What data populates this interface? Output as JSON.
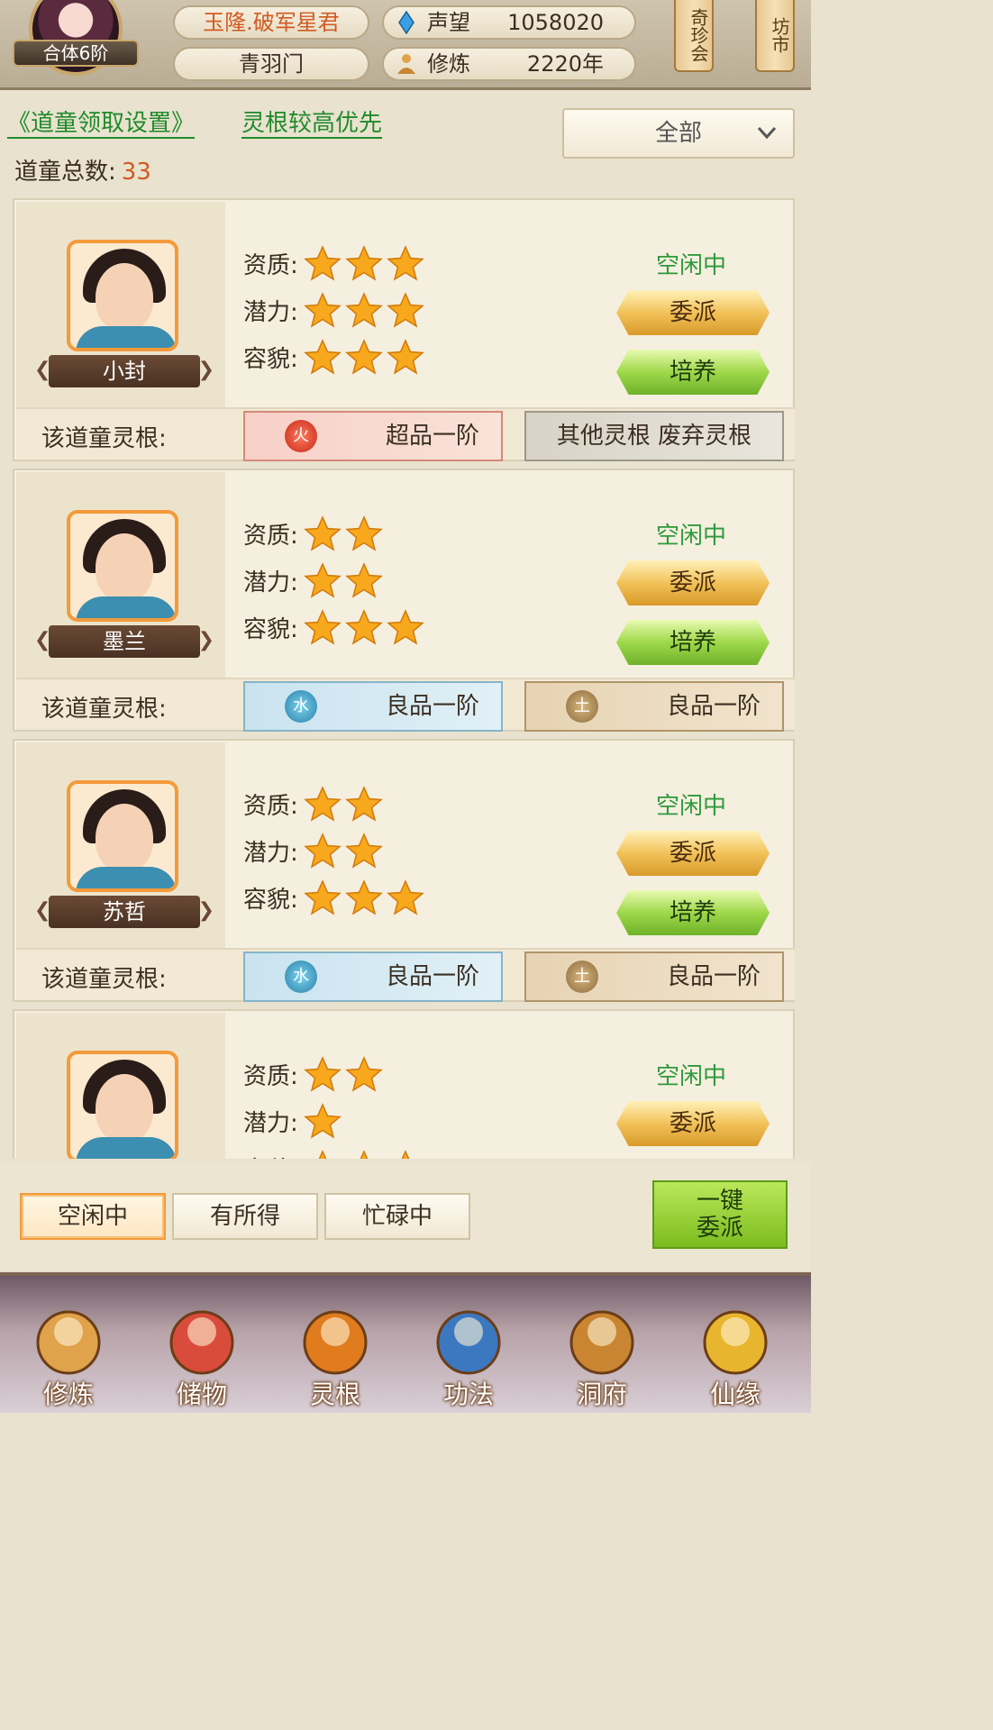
{
  "header": {
    "avatar_rank": "合体6阶",
    "title": "玉隆.破军星君",
    "sect": "青羽门",
    "reputation_label": "声望",
    "reputation_value": "1058020",
    "cultivation_label": "修炼",
    "cultivation_value": "2220年",
    "side_tabs": [
      "奇珍会",
      "坊市"
    ]
  },
  "settings": {
    "pickup_link": "《道童领取设置》",
    "priority_link": "灵根较高优先",
    "filter_selected": "全部",
    "total_label": "道童总数:",
    "total_value": "33"
  },
  "labels": {
    "aptitude": "资质:",
    "potential": "潜力:",
    "appearance": "容貌:",
    "spirit_root": "该道童灵根:",
    "assign": "委派",
    "train": "培养"
  },
  "disciples": [
    {
      "name": "小封",
      "status": "空闲中",
      "aptitude": 3,
      "potential": 3,
      "appearance": 3,
      "roots": [
        {
          "element": "火",
          "grade": "超品一阶",
          "kind": "fire"
        },
        {
          "element": "",
          "grade": "其他灵根 废弃灵根",
          "kind": "other"
        }
      ]
    },
    {
      "name": "墨兰",
      "status": "空闲中",
      "aptitude": 2,
      "potential": 2,
      "appearance": 3,
      "roots": [
        {
          "element": "水",
          "grade": "良品一阶",
          "kind": "water"
        },
        {
          "element": "土",
          "grade": "良品一阶",
          "kind": "earth"
        }
      ]
    },
    {
      "name": "苏哲",
      "status": "空闲中",
      "aptitude": 2,
      "potential": 2,
      "appearance": 3,
      "roots": [
        {
          "element": "水",
          "grade": "良品一阶",
          "kind": "water"
        },
        {
          "element": "土",
          "grade": "良品一阶",
          "kind": "earth"
        }
      ]
    },
    {
      "name": "",
      "status": "空闲中",
      "aptitude": 2,
      "potential": 1,
      "appearance": 3,
      "roots": []
    }
  ],
  "tabs": [
    "空闲中",
    "有所得",
    "忙碌中"
  ],
  "active_tab": "空闲中",
  "one_key_assign": [
    "一键",
    "委派"
  ],
  "nav": [
    {
      "label": "修炼",
      "icon": "meditation-icon"
    },
    {
      "label": "储物",
      "icon": "bag-icon"
    },
    {
      "label": "灵根",
      "icon": "spirit-root-icon"
    },
    {
      "label": "功法",
      "icon": "book-icon"
    },
    {
      "label": "洞府",
      "icon": "pavilion-icon"
    },
    {
      "label": "仙缘",
      "icon": "gourd-icon"
    }
  ],
  "colors": {
    "accent_orange": "#d15a23",
    "status_green": "#2e9a3b",
    "assign_gold": "#f2c25a",
    "train_green": "#9fd84a"
  }
}
